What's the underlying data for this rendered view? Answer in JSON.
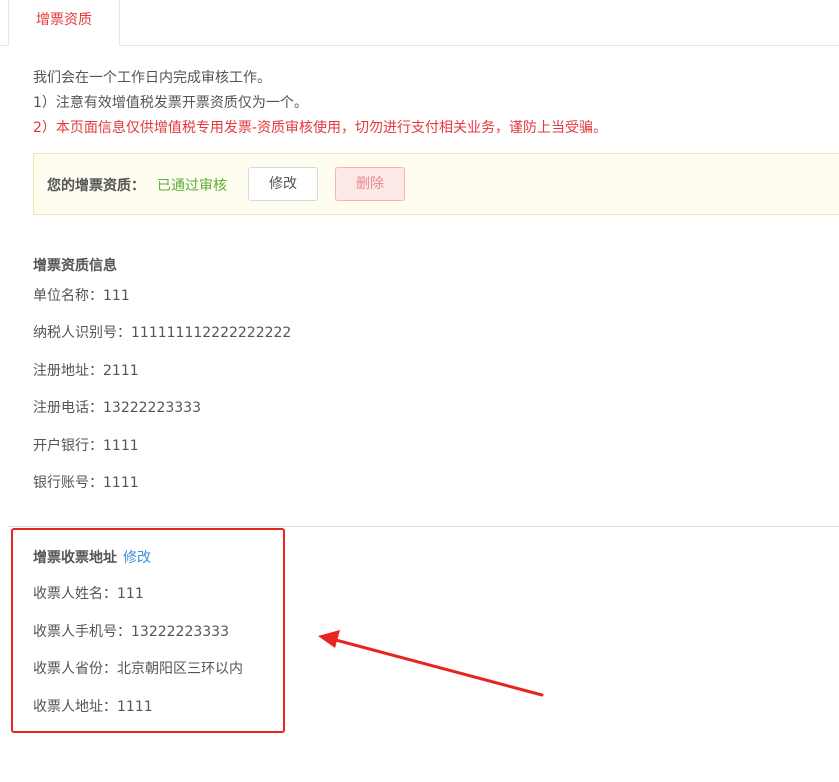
{
  "tabs": [
    {
      "label": "增票资质",
      "active": true
    }
  ],
  "notices": [
    "我们会在一个工作日内完成审核工作。",
    "1）注意有效增值税发票开票资质仅为一个。",
    "2）本页面信息仅供增值税专用发票-资质审核使用，切勿进行支付相关业务，谨防上当受骗。"
  ],
  "status": {
    "label": "您的增票资质：",
    "value": "已通过审核",
    "edit_label": "修改",
    "delete_label": "删除"
  },
  "qualification": {
    "title": "增票资质信息",
    "rows": [
      "单位名称：111",
      "纳税人识别号：111111112222222222",
      "注册地址：2111",
      "注册电话：13222223333",
      "开户银行：1111",
      "银行账号：1111"
    ]
  },
  "address": {
    "title": "增票收票地址",
    "edit_label": "修改",
    "rows": [
      "收票人姓名：111",
      "收票人手机号：13222223333",
      "收票人省份：北京朝阳区三环以内",
      "收票人地址：1111"
    ]
  },
  "colors": {
    "accent": "#e4393c",
    "success": "#5cad3b",
    "link": "#3b8ee0",
    "annotation": "#e8241f"
  }
}
